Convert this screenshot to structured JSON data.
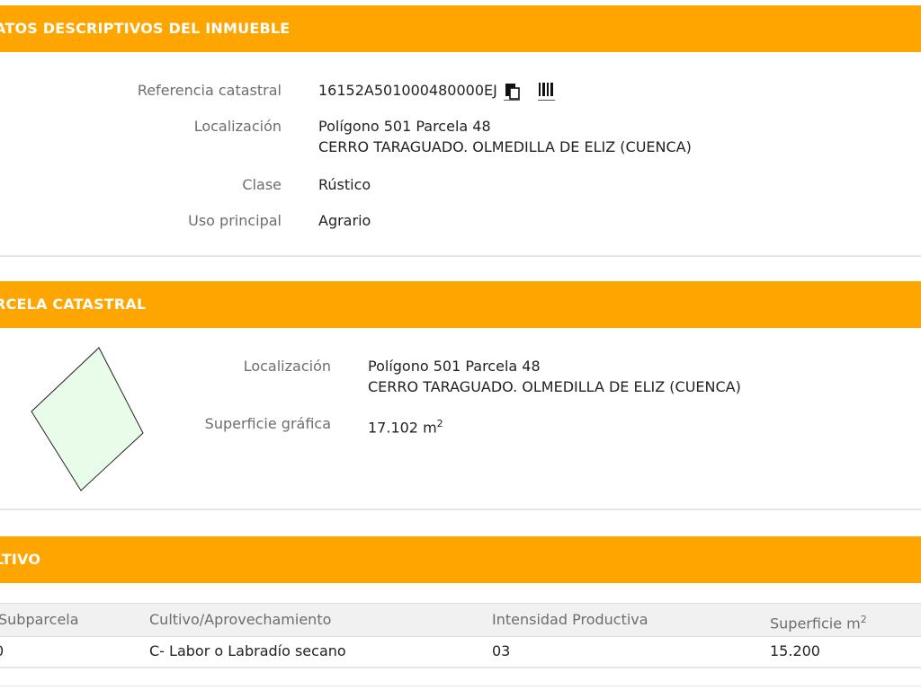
{
  "descriptive": {
    "title": "ATOS DESCRIPTIVOS DEL INMUEBLE",
    "ref_label": "Referencia catastral",
    "ref_value": "16152A501000480000EJ",
    "loc_label": "Localización",
    "loc_line1": "Polígono 501 Parcela 48",
    "loc_line2": "CERRO TARAGUADO. OLMEDILLA DE ELIZ (CUENCA)",
    "clase_label": "Clase",
    "clase_value": "Rústico",
    "uso_label": "Uso principal",
    "uso_value": "Agrario"
  },
  "parcela": {
    "title": "RCELA CATASTRAL",
    "loc_label": "Localización",
    "loc_line1": "Polígono 501 Parcela 48",
    "loc_line2": "CERRO TARAGUADO. OLMEDILLA DE ELIZ (CUENCA)",
    "sup_label": "Superficie gráfica",
    "sup_value": "17.102 m",
    "sup_exp": "2",
    "shape_fill": "#e9fbe9"
  },
  "cultivo": {
    "title": "LTIVO",
    "headers": {
      "subparcela": "Subparcela",
      "cultivo": "Cultivo/Aprovechamiento",
      "intensidad": "Intensidad Productiva",
      "superficie": "Superficie m",
      "superficie_exp": "2"
    },
    "rows": [
      {
        "subparcela": "0",
        "cultivo": "C- Labor o Labradío secano",
        "intensidad": "03",
        "superficie": "15.200"
      }
    ]
  },
  "colors": {
    "header_bg": "#ffa500",
    "label": "#6d6d6d",
    "value": "#222222"
  }
}
